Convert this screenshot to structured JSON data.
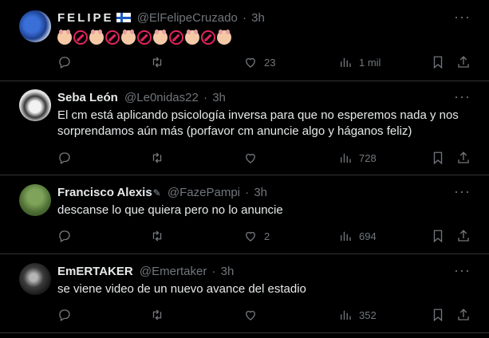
{
  "tweets": [
    {
      "name": "FELIPE",
      "handle": "@ElFelipeCruzado",
      "time": "3h",
      "text": "",
      "replies": "",
      "retweets": "",
      "likes": "23",
      "views": "1 mil"
    },
    {
      "name": "Seba León",
      "handle": "@Le0nidas22",
      "time": "3h",
      "text": "El cm está aplicando psicología inversa para que no esperemos nada y nos sorprendamos aún más (porfavor cm anuncie algo y háganos feliz)",
      "replies": "",
      "retweets": "",
      "likes": "",
      "views": "728"
    },
    {
      "name": "Francisco Alexis",
      "handle": "@FazePampi",
      "time": "3h",
      "text": "descanse lo que quiera pero no lo anuncie",
      "replies": "",
      "retweets": "",
      "likes": "2",
      "views": "694"
    },
    {
      "name": "EmERTAKER",
      "handle": "@Emertaker",
      "time": "3h",
      "text": "se viene  video de un nuevo avance del estadio",
      "replies": "",
      "retweets": "",
      "likes": "",
      "views": "352"
    }
  ],
  "separator": "·",
  "icons": [
    "reply-icon",
    "retweet-icon",
    "like-icon",
    "views-icon",
    "bookmark-icon",
    "more-icon"
  ]
}
